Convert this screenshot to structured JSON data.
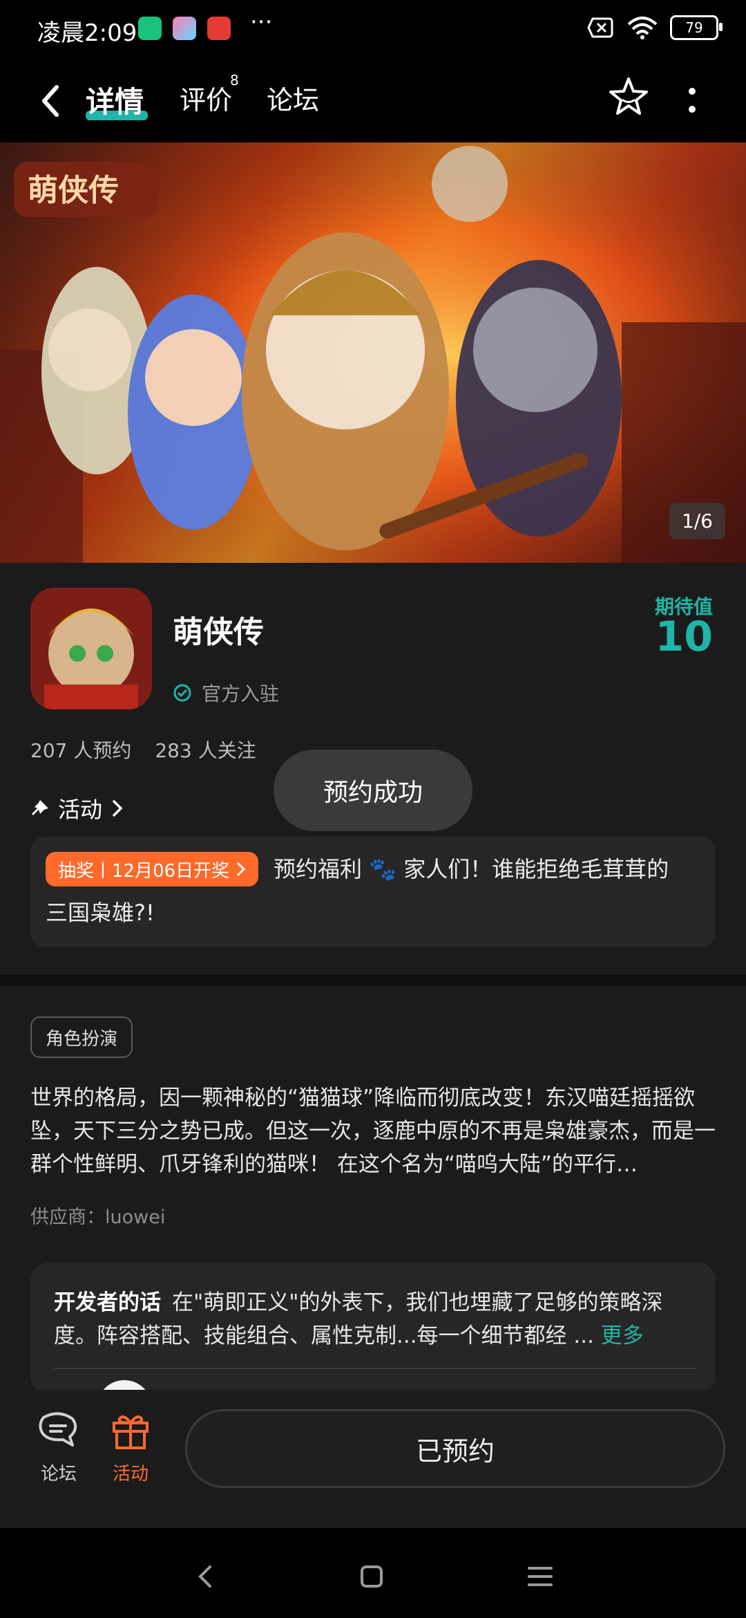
{
  "status_bar": {
    "time": "凌晨2:09",
    "battery": "79",
    "more": "···"
  },
  "header": {
    "tabs": [
      {
        "label": "详情",
        "active": true
      },
      {
        "label": "评价",
        "badge": "8"
      },
      {
        "label": "论坛"
      }
    ],
    "icons": [
      "back-arrow-icon",
      "star-icon",
      "more-vertical-icon"
    ]
  },
  "banner": {
    "page_indicator": "1/6",
    "logo_text": "萌侠传"
  },
  "game": {
    "name": "萌侠传",
    "official": "官方入驻",
    "expect_label": "期待值",
    "expect_value": "10",
    "reservations": "207 人预约",
    "followers": "283 人关注"
  },
  "activity": {
    "title": "活动",
    "chip": "抽奖丨12月06日开奖",
    "line1": "预约福利 🐾 家人们！谁能拒绝毛茸茸的",
    "line2": "三国枭雄?!"
  },
  "toast": "预约成功",
  "description": {
    "tag": "角色扮演",
    "text": "世界的格局，因一颗神秘的“猫猫球”降临而彻底改变！东汉喵廷摇摇欲坠，天下三分之势已成。但这一次，逐鹿中原的不再是枭雄豪杰，而是一群个性鲜明、爪牙锋利的猫咪！ 在这个名为“喵呜大陆”的平行…",
    "supplier": "供应商：luowei"
  },
  "developer": {
    "title": "开发者的话",
    "text": "在\"萌即正义\"的外表下，我们也埋藏了足够的策略深度。阵容搭配、技能组合、属性克制...每一个细节都经 ...",
    "more": "更多"
  },
  "bottom_bar": {
    "forum_label": "论坛",
    "activity_label": "活动",
    "reserved_label": "已预约"
  },
  "colors": {
    "accent": "#1fb5a8",
    "orange": "#ff6a2b",
    "background": "#1b1b1b"
  }
}
